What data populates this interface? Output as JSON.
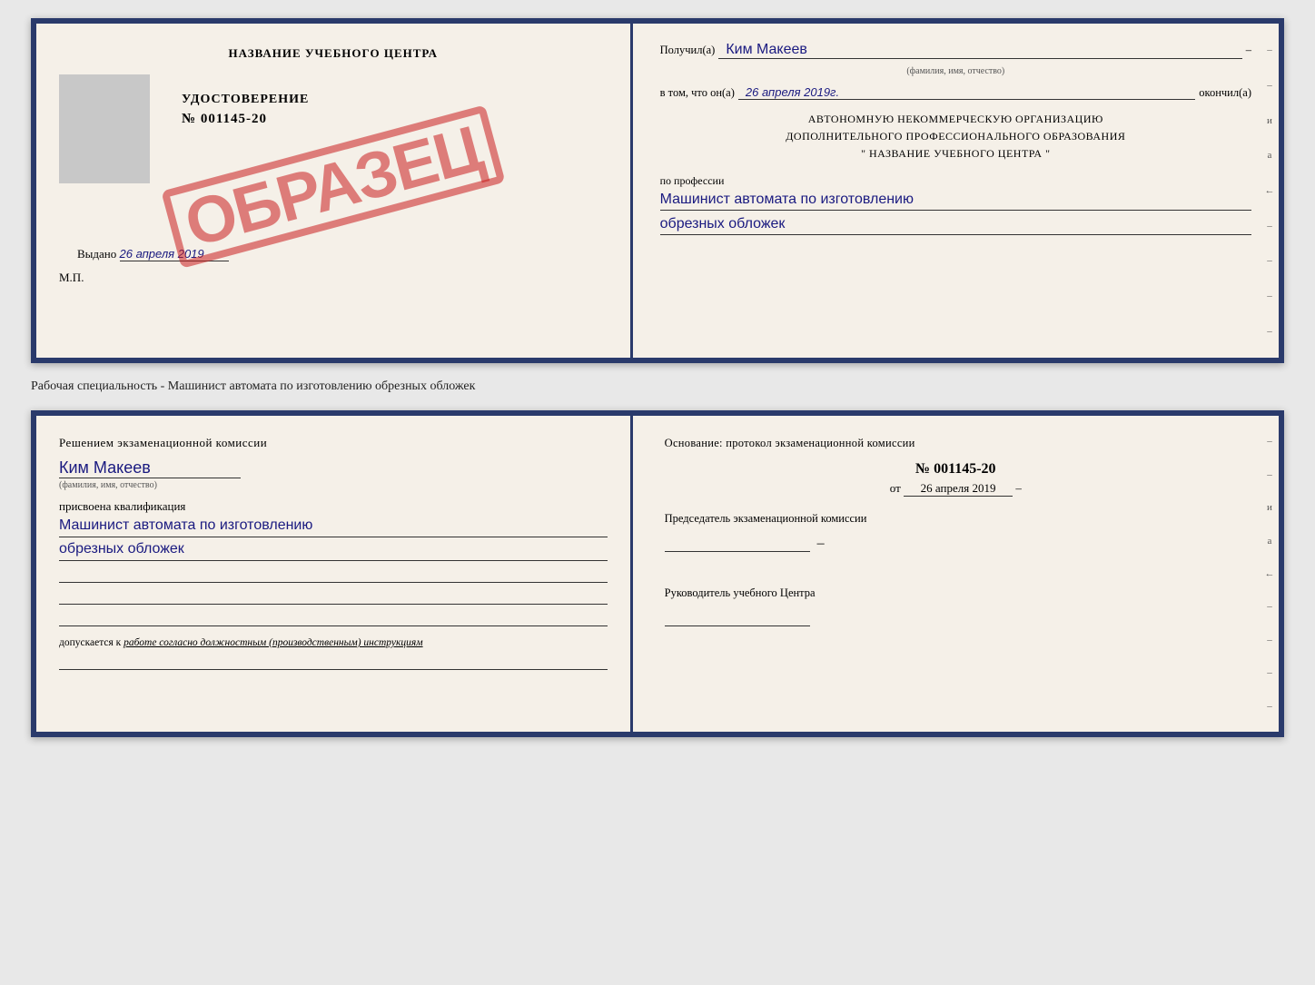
{
  "top_document": {
    "left": {
      "title": "НАЗВАНИЕ УЧЕБНОГО ЦЕНТРА",
      "cert_type": "УДОСТОВЕРЕНИЕ",
      "cert_number": "№ 001145-20",
      "vydano_label": "Выдано",
      "vydano_date": "26 апреля 2019",
      "mp_label": "М.П.",
      "stamp": "ОБРАЗЕЦ"
    },
    "right": {
      "poluchil_label": "Получил(а)",
      "poluchil_name": "Ким Макеев",
      "fio_sublabel": "(фамилия, имя, отчество)",
      "vtom_label": "в том, что он(а)",
      "vtom_date": "26 апреля 2019г.",
      "okonchil_label": "окончил(а)",
      "org_line1": "АВТОНОМНУЮ НЕКОММЕРЧЕСКУЮ ОРГАНИЗАЦИЮ",
      "org_line2": "ДОПОЛНИТЕЛЬНОГО ПРОФЕССИОНАЛЬНОГО ОБРАЗОВАНИЯ",
      "org_line3": "\"   НАЗВАНИЕ УЧЕБНОГО ЦЕНТРА   \"",
      "profession_label": "по профессии",
      "profession_line1": "Машинист автомата по изготовлению",
      "profession_line2": "обрезных обложек"
    }
  },
  "caption": "Рабочая специальность - Машинист автомата по изготовлению обрезных обложек",
  "bottom_document": {
    "left": {
      "resheniem_label": "Решением экзаменационной комиссии",
      "fio_name": "Ким Макеев",
      "fio_sublabel": "(фамилия, имя, отчество)",
      "prisvoena_label": "присвоена квалификация",
      "qualification_line1": "Машинист автомата по изготовлению",
      "qualification_line2": "обрезных обложек",
      "dopusk_label": "допускается к",
      "dopusk_text": "работе согласно должностным (производственным) инструкциям"
    },
    "right": {
      "osnovanie_label": "Основание: протокол экзаменационной комиссии",
      "protocol_num": "№  001145-20",
      "protocol_date_prefix": "от",
      "protocol_date": "26 апреля 2019",
      "chairman_label": "Председатель экзаменационной комиссии",
      "head_label": "Руководитель учебного Центра"
    }
  },
  "side_chars": [
    "-",
    "–",
    "и",
    "а",
    "←",
    "–",
    "–",
    "–",
    "–"
  ]
}
